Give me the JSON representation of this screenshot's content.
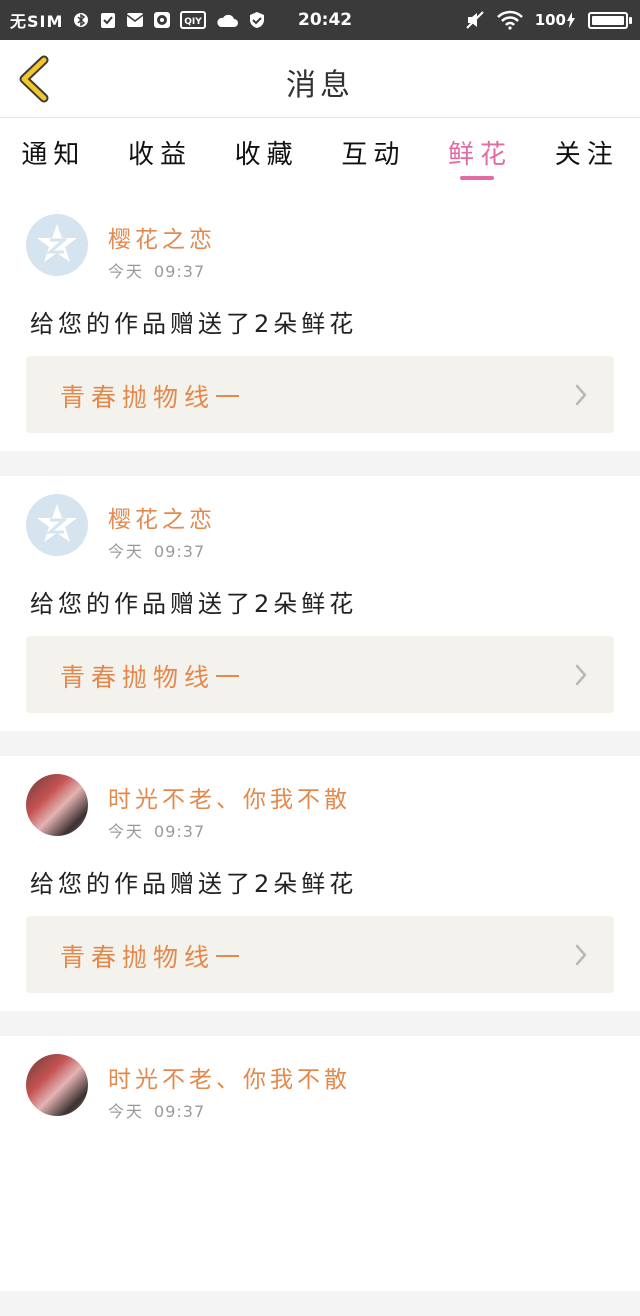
{
  "status_bar": {
    "carrier": "无SIM",
    "time": "20:42",
    "battery": "100",
    "icons": [
      "bluetooth-icon",
      "clipboard-check-icon",
      "mail-icon",
      "browser-icon",
      "iqiyi-icon",
      "cloud-icon",
      "shield-icon",
      "mute-icon",
      "wifi-icon",
      "charging-icon"
    ]
  },
  "nav": {
    "title": "消息",
    "back_icon": "chevron-left-icon",
    "accent": "#f3c62b"
  },
  "tabs": [
    {
      "label": "通知",
      "active": false
    },
    {
      "label": "收益",
      "active": false
    },
    {
      "label": "收藏",
      "active": false
    },
    {
      "label": "互动",
      "active": false
    },
    {
      "label": "鲜花",
      "active": true
    },
    {
      "label": "关注",
      "active": false
    }
  ],
  "colors": {
    "accent_pink": "#e26aa5",
    "name_orange": "#e3894d"
  },
  "messages": [
    {
      "username": "樱花之恋",
      "day": "今天",
      "time": "09:37",
      "text": "给您的作品赠送了2朵鲜花",
      "work_title": "青春抛物线一",
      "avatar": "default-avatar"
    },
    {
      "username": "樱花之恋",
      "day": "今天",
      "time": "09:37",
      "text": "给您的作品赠送了2朵鲜花",
      "work_title": "青春抛物线一",
      "avatar": "default-avatar"
    },
    {
      "username": "时光不老、你我不散",
      "day": "今天",
      "time": "09:37",
      "text": "给您的作品赠送了2朵鲜花",
      "work_title": "青春抛物线一",
      "avatar": "photo-avatar"
    },
    {
      "username": "时光不老、你我不散",
      "day": "今天",
      "time": "09:37",
      "text": "",
      "work_title": "",
      "avatar": "photo-avatar"
    }
  ]
}
